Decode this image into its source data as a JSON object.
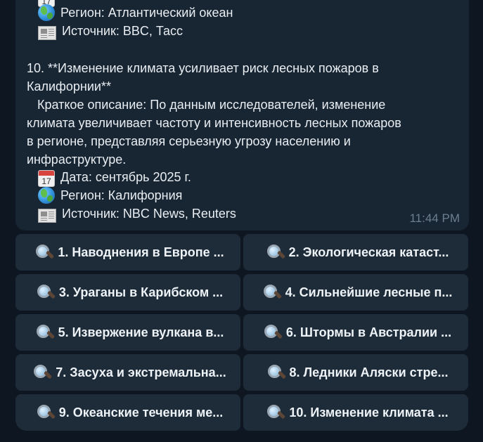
{
  "message": {
    "prev_item": {
      "region": "Регион: Атлантический океан",
      "source": "Источник: BBC, Тасс"
    },
    "item10": {
      "title_line1": "10. **Изменение климата усиливает риск лесных пожаров в",
      "title_line2": "Калифорнии**",
      "summary_line1": "   Краткое описание: По данным исследователей, изменение",
      "summary_line2": "климата увеличивает частоту и интенсивность лесных пожаров",
      "summary_line3": "в регионе, представляя серьезную угрозу населению и",
      "summary_line4": "инфраструктуре.",
      "date": "Дата: сентябрь 2025 г.",
      "region": "Регион: Калифорния",
      "source": "Источник: NBC News, Reuters"
    },
    "calendar_day": "17",
    "time": "11:44 PM"
  },
  "icons": {
    "calendar": "calendar-icon",
    "globe": "globe-icon",
    "newspaper": "newspaper-icon",
    "search": "magnifying-glass-icon"
  },
  "keyboard": {
    "buttons": [
      "1. Наводнения в Европе ...",
      "2. Экологическая катаст...",
      "3. Ураганы в Карибском ...",
      "4. Сильнейшие лесные п...",
      "5. Извержение вулкана в...",
      "6. Штормы в Австралии ...",
      "7. Засуха и экстремальна...",
      "8. Ледники Аляски стре...",
      "9. Океанские течения ме...",
      "10. Изменение климата ..."
    ]
  }
}
